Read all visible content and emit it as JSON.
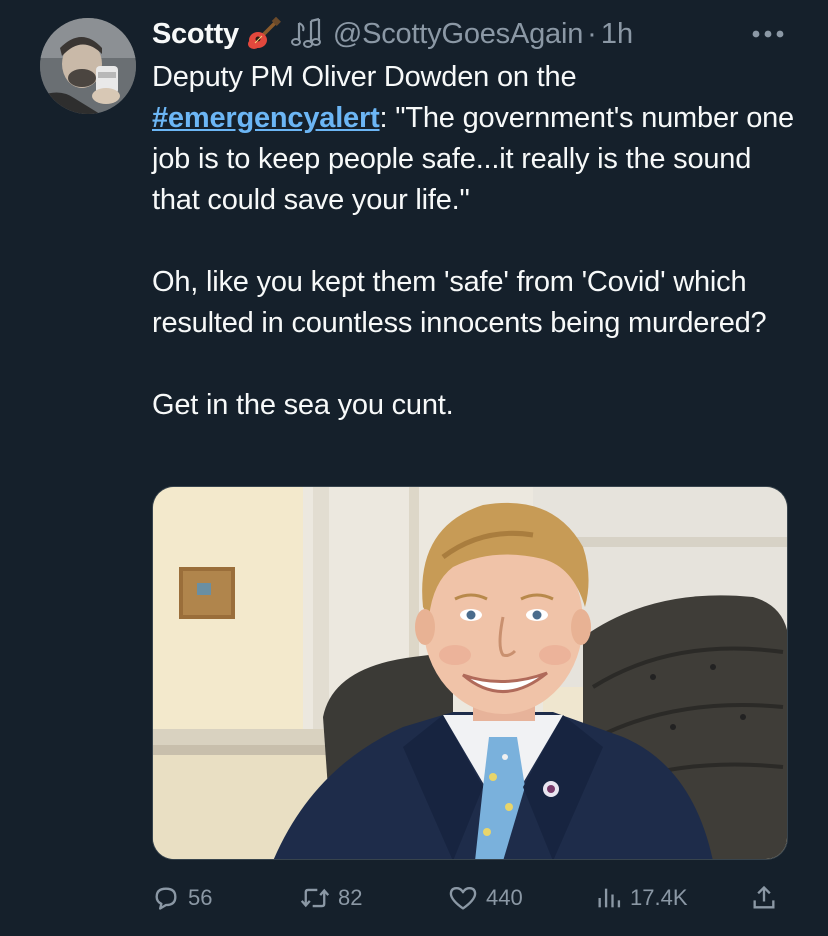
{
  "tweet": {
    "display_name": "Scotty",
    "handle": "@ScottyGoesAgain",
    "separator": "·",
    "time": "1h",
    "more_icon": "more-horizontal-icon",
    "text": {
      "line1": "Deputy PM Oliver Dowden on the",
      "hashtag": "#emergencyalert",
      "after_hashtag": ": \"The government's number one job is to keep people safe...it really is the sound that could save your life.\"",
      "paragraph2": "Oh, like you kept them 'safe' from 'Covid' which resulted in countless innocents being murdered?",
      "paragraph3": "Get in the sea you cunt."
    },
    "media": {
      "icon": "photo-of-man-in-armchair"
    },
    "actions": {
      "replies": "56",
      "retweets": "82",
      "likes": "440",
      "views": "17.4K"
    }
  },
  "colors": {
    "background": "#15202b",
    "text": "#f7f9f9",
    "muted": "#8b98a5",
    "link": "#6cb6f5"
  }
}
